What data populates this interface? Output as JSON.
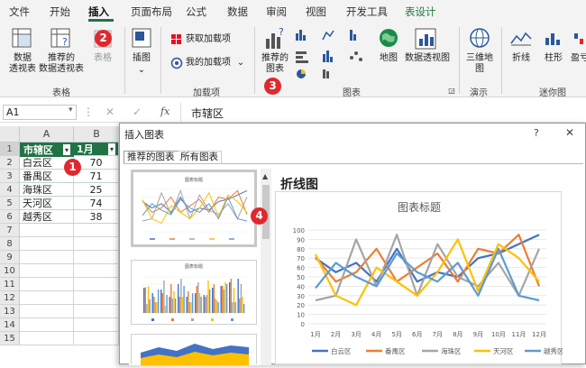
{
  "menu": [
    "文件",
    "开始",
    "插入",
    "页面布局",
    "公式",
    "数据",
    "审阅",
    "视图",
    "开发工具",
    "表设计"
  ],
  "ribbon": {
    "pivot": "数据\n透视表",
    "rec_pivot": "推荐的\n数据透视表",
    "table": "表格",
    "illus": "插图",
    "get_addins": "获取加载项",
    "my_addins": "我的加载项",
    "rec_charts": "推荐的\n图表",
    "map": "地图",
    "pivot_chart": "数据透视图",
    "map3d": "三维地\n图",
    "line": "折线",
    "column": "柱形",
    "win_loss": "盈亏",
    "groups": {
      "tables": "表格",
      "addins": "加载项",
      "charts": "图表",
      "tours": "演示",
      "sparklines": "迷你图"
    }
  },
  "badges": [
    "1",
    "2",
    "3",
    "4"
  ],
  "formula_bar": {
    "namebox": "A1",
    "fx": "fx",
    "content": "市辖区"
  },
  "sheet": {
    "cols": [
      "A",
      "B"
    ],
    "rows": [
      "1",
      "2",
      "3",
      "4",
      "5",
      "6",
      "7",
      "8",
      "9",
      "10",
      "11",
      "12",
      "13",
      "14",
      "15"
    ],
    "header": [
      "市辖区",
      "1月"
    ],
    "data": [
      [
        "白云区",
        "70"
      ],
      [
        "番禺区",
        "71"
      ],
      [
        "海珠区",
        "25"
      ],
      [
        "天河区",
        "74"
      ],
      [
        "越秀区",
        "38"
      ]
    ]
  },
  "dialog": {
    "title": "插入图表",
    "help": "?",
    "close": "✕",
    "tabs": [
      "推荐的图表",
      "所有图表"
    ],
    "thumb1_title": "图表标题",
    "thumb2_title": "图表标题",
    "preview_type": "折线图"
  },
  "chart_data": {
    "type": "line",
    "title": "图表标题",
    "categories": [
      "1月",
      "2月",
      "3月",
      "4月",
      "5月",
      "6月",
      "7月",
      "8月",
      "9月",
      "10月",
      "11月",
      "12月"
    ],
    "ylim": [
      0,
      100
    ],
    "yticks": [
      0,
      10,
      20,
      30,
      40,
      50,
      60,
      70,
      80,
      90,
      100
    ],
    "series": [
      {
        "name": "白云区",
        "color": "#4472c4",
        "values": [
          70,
          55,
          65,
          45,
          80,
          45,
          55,
          50,
          70,
          75,
          85,
          95
        ]
      },
      {
        "name": "番禺区",
        "color": "#ed7d31",
        "values": [
          71,
          45,
          55,
          80,
          45,
          60,
          75,
          45,
          80,
          75,
          95,
          40
        ]
      },
      {
        "name": "海珠区",
        "color": "#a5a5a5",
        "values": [
          25,
          30,
          90,
          40,
          95,
          30,
          85,
          50,
          40,
          65,
          30,
          80
        ]
      },
      {
        "name": "天河区",
        "color": "#ffc000",
        "values": [
          74,
          30,
          20,
          60,
          45,
          30,
          55,
          90,
          35,
          85,
          70,
          45
        ]
      },
      {
        "name": "越秀区",
        "color": "#5b9bd5",
        "values": [
          38,
          65,
          50,
          40,
          75,
          55,
          45,
          65,
          30,
          80,
          30,
          25
        ]
      }
    ]
  }
}
